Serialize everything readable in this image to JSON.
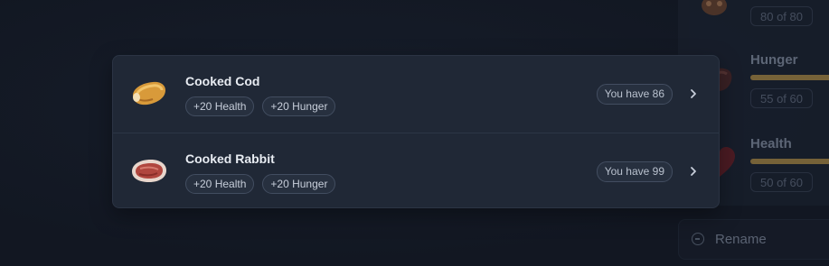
{
  "background_panel": {
    "stats": [
      {
        "label": "",
        "value_text": "80 of 80",
        "fill": 1.0
      },
      {
        "label": "Hunger",
        "value_text": "55 of 60",
        "fill": 0.9167
      },
      {
        "label": "Health",
        "value_text": "50 of 60",
        "fill": 0.8333
      }
    ],
    "rename_label": "Rename"
  },
  "food_list": {
    "items": [
      {
        "name": "Cooked Cod",
        "icon": "cooked-cod-icon",
        "effects": [
          "+20 Health",
          "+20 Hunger"
        ],
        "owned_text": "You have 86"
      },
      {
        "name": "Cooked Rabbit",
        "icon": "cooked-rabbit-icon",
        "effects": [
          "+20 Health",
          "+20 Hunger"
        ],
        "owned_text": "You have 99"
      }
    ]
  },
  "colors": {
    "page_bg": "#141a26",
    "popup_bg": "#202836",
    "tag_border": "#424d60",
    "bar_fill": "#c8a04a"
  }
}
